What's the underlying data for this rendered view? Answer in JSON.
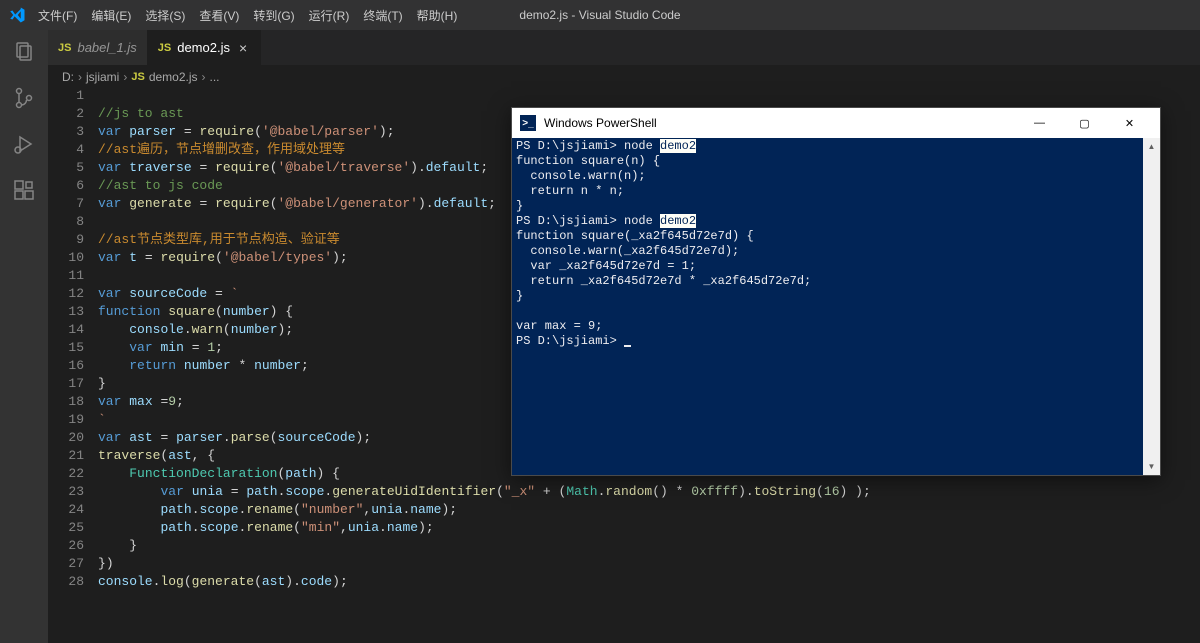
{
  "window": {
    "title": "demo2.js - Visual Studio Code"
  },
  "menu": {
    "file": "文件(F)",
    "edit": "编辑(E)",
    "select": "选择(S)",
    "view": "查看(V)",
    "goto": "转到(G)",
    "run": "运行(R)",
    "terminal": "终端(T)",
    "help": "帮助(H)"
  },
  "tabs": [
    {
      "badge": "JS",
      "label": "babel_1.js",
      "active": false
    },
    {
      "badge": "JS",
      "label": "demo2.js",
      "active": true
    }
  ],
  "breadcrumb": {
    "p1": "D:",
    "p2": "jsjiami",
    "badge": "JS",
    "p3": "demo2.js",
    "p4": "..."
  },
  "code": {
    "lines": [
      "",
      "//js to ast",
      "var parser = require('@babel/parser');",
      "//ast遍历，节点增删改查，作用域处理等",
      "var traverse = require('@babel/traverse').default;",
      "//ast to js code",
      "var generate = require('@babel/generator').default;",
      "",
      "//ast节点类型库,用于节点构造、验证等",
      "var t = require('@babel/types');",
      "",
      "var sourceCode = `",
      "function square(number) {",
      "    console.warn(number);",
      "    var min = 1;",
      "    return number * number;",
      "}",
      "var max =9;",
      "`",
      "var ast = parser.parse(sourceCode);",
      "traverse(ast, {",
      "    FunctionDeclaration(path) {",
      "        var unia = path.scope.generateUidIdentifier(\"_x\" + (Math.random() * 0xffff).toString(16) );",
      "        path.scope.rename(\"number\",unia.name);",
      "        path.scope.rename(\"min\",unia.name);",
      "    }",
      "})",
      "console.log(generate(ast).code);"
    ]
  },
  "powershell": {
    "title": "Windows PowerShell",
    "lines": [
      {
        "prompt": "PS D:\\jsjiami> ",
        "cmd": "node ",
        "hl": "demo2",
        "sel": true
      },
      {
        "text": "function square(n) {"
      },
      {
        "text": "  console.warn(n);"
      },
      {
        "text": "  return n * n;"
      },
      {
        "text": "}"
      },
      {
        "prompt": "PS D:\\jsjiami> ",
        "cmd": "node ",
        "hl": "demo2"
      },
      {
        "text": "function square(_xa2f645d72e7d) {"
      },
      {
        "text": "  console.warn(_xa2f645d72e7d);"
      },
      {
        "text": "  var _xa2f645d72e7d = 1;"
      },
      {
        "text": "  return _xa2f645d72e7d * _xa2f645d72e7d;"
      },
      {
        "text": "}"
      },
      {
        "text": ""
      },
      {
        "text": "var max = 9;"
      },
      {
        "prompt": "PS D:\\jsjiami> ",
        "cursor": true
      }
    ]
  }
}
